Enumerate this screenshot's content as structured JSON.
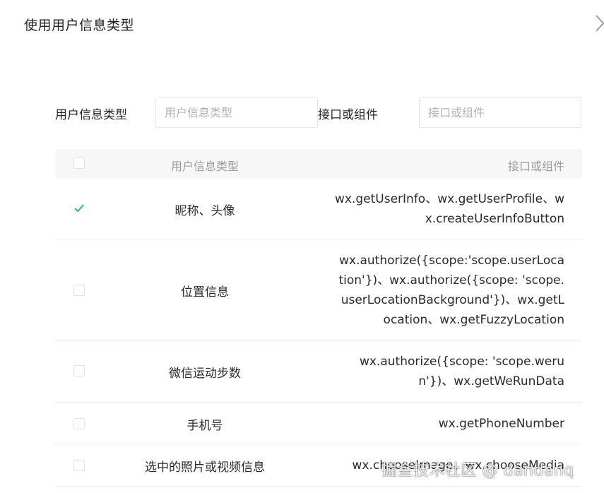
{
  "dialog": {
    "title": "使用用户信息类型"
  },
  "filters": {
    "type_label": "用户信息类型",
    "type_placeholder": "用户信息类型",
    "api_label": "接口或组件",
    "api_placeholder": "接口或组件"
  },
  "table": {
    "headers": {
      "type": "用户信息类型",
      "api": "接口或组件"
    },
    "rows": [
      {
        "checked": true,
        "type": "昵称、头像",
        "api": "wx.getUserInfo、wx.getUserProfile、wx.createUserInfoButton"
      },
      {
        "checked": false,
        "type": "位置信息",
        "api": "wx.authorize({scope:'scope.userLocation'})、wx.authorize({scope: 'scope.userLocationBackground'})、wx.getLocation、wx.getFuzzyLocation"
      },
      {
        "checked": false,
        "type": "微信运动步数",
        "api": "wx.authorize({scope: 'scope.werun'})、wx.getWeRunData"
      },
      {
        "checked": false,
        "type": "手机号",
        "api": "wx.getPhoneNumber"
      },
      {
        "checked": false,
        "type": "选中的照片或视频信息",
        "api": "wx.chooseImage、wx.chooseMedia"
      }
    ]
  },
  "watermark": "掘金技术社区 @ dandanq",
  "colors": {
    "check": "#07c160",
    "header_bg": "#f7f7f7",
    "border": "#ececec"
  },
  "icons": {
    "close": "chevron-right-icon",
    "check": "checkmark-icon"
  }
}
